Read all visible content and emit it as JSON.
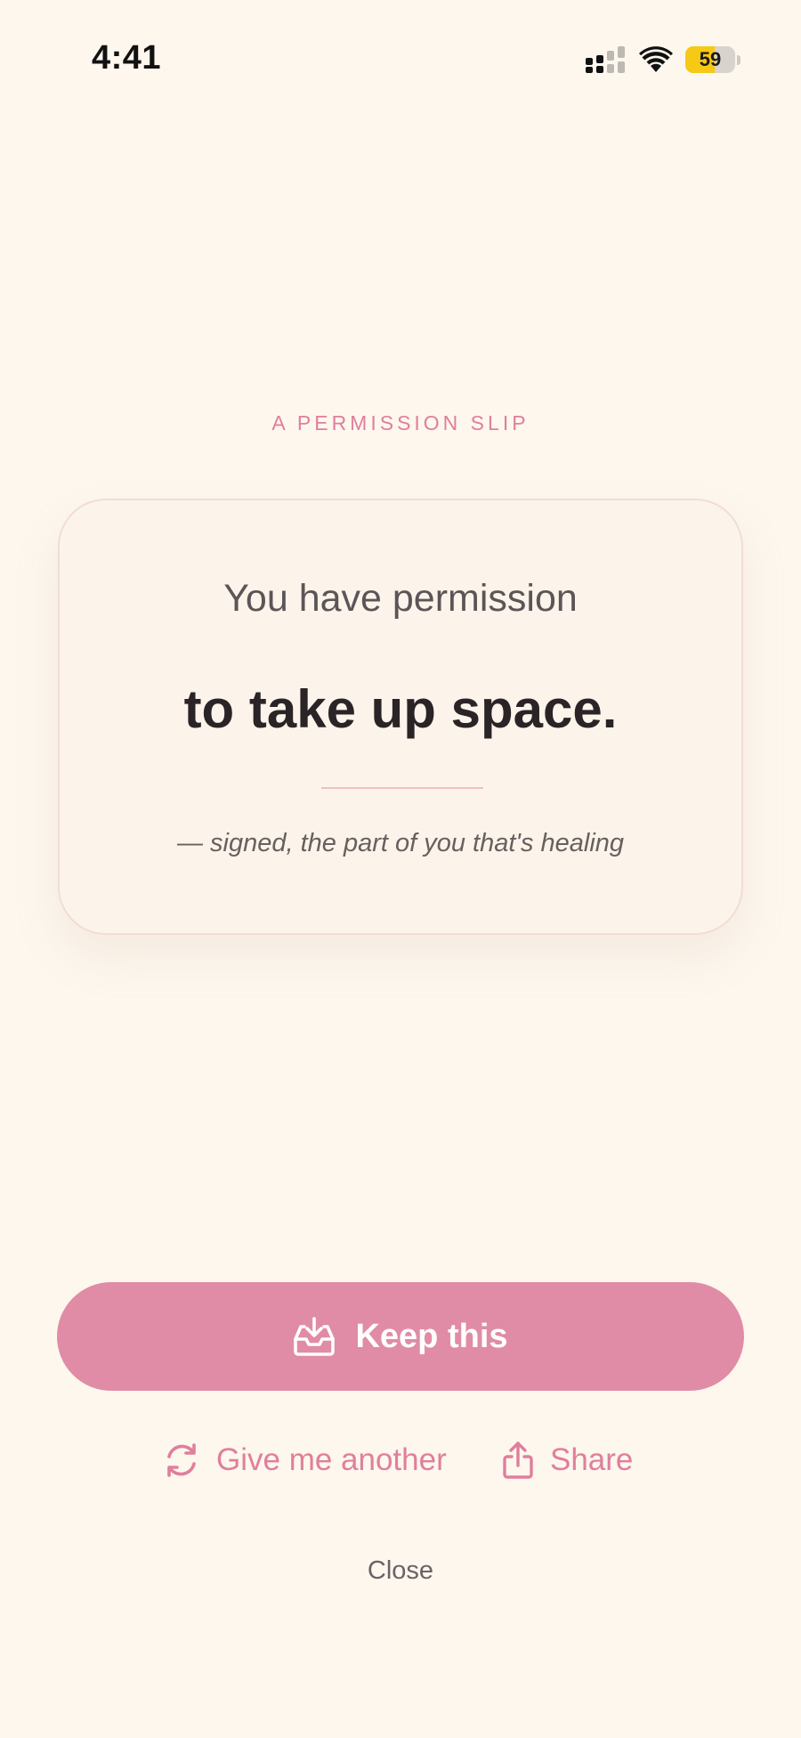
{
  "status_bar": {
    "time": "4:41",
    "battery_level": "59",
    "battery_fraction": 0.59,
    "icons": [
      "signal-icon",
      "wifi-icon",
      "battery-icon"
    ]
  },
  "eyebrow": "A PERMISSION SLIP",
  "slip": {
    "lead": "You have permission",
    "main": "to take up space.",
    "signature": "— signed, the part of you that's healing"
  },
  "actions": {
    "keep_label": "Keep this",
    "keep_icon": "tray-download-icon",
    "another_label": "Give me another",
    "another_icon": "refresh-icon",
    "share_label": "Share",
    "share_icon": "share-icon",
    "close_label": "Close"
  },
  "colors": {
    "background": "#fdf7ee",
    "accent": "#e08ca6",
    "accent_text": "#e07f9c",
    "battery": "#f6c915"
  }
}
